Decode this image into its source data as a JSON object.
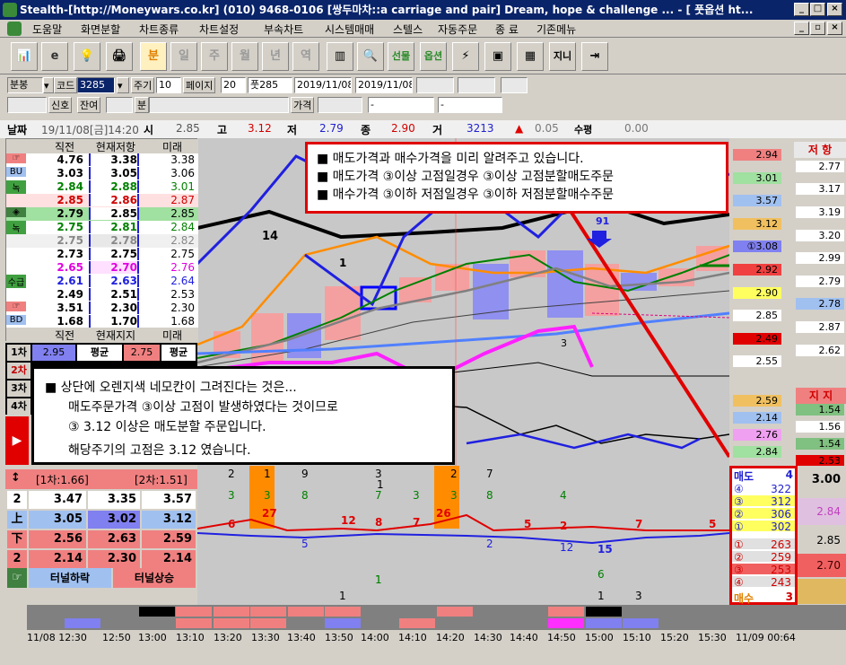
{
  "window": {
    "title": "Stealth-[http://Moneywars.co.kr] (010) 9468-0106 [쌍두마차::a carriage and pair] Dream, hope & challenge ... - [ 풋옵션 ht...",
    "controls": [
      "_",
      "□",
      "×"
    ],
    "mdi_controls": [
      "_",
      "▫",
      "×"
    ]
  },
  "menu": {
    "items": [
      "도움말",
      "화면분할",
      "차트종류",
      "차트설정",
      "부속차트",
      "시스템매매",
      "스텔스",
      "자동주문",
      "종 료",
      "기존메뉴"
    ]
  },
  "toolbar": {
    "buttons": [
      "📊",
      "e",
      "💡",
      "🖨",
      "분",
      "일",
      "주",
      "월",
      "년",
      "역",
      "▥",
      "🔍",
      "선물",
      "옵션",
      "⚡",
      "▣",
      "▦",
      "지니",
      "⇥"
    ]
  },
  "controls": {
    "period_select": "분봉",
    "code_label": "코드",
    "code_value": "3285",
    "cycle_label": "주기",
    "cycle_value": "10",
    "page_label": "페이지",
    "page_value": "20",
    "put_label": "풋285",
    "date_from": "2019/11/08",
    "date_to": "2019/11/08",
    "signal_label": "신호",
    "balance_label": "잔여",
    "min_label": "분",
    "price_label": "가격",
    "dash1": "-",
    "dash2": "-"
  },
  "price_bar": {
    "date_label": "날짜",
    "datetime": "19/11/08[금]14:20",
    "open_label": "시",
    "open": "2.85",
    "high_label": "고",
    "high": "3.12",
    "low_label": "저",
    "low": "2.79",
    "close_label": "종",
    "close": "2.90",
    "volume_label": "거",
    "volume": "3213",
    "change": "0.05",
    "amount_label": "수평",
    "amount": "0.00"
  },
  "left_table": {
    "headers": [
      "직전",
      "현재저항",
      "미래"
    ],
    "rows": [
      {
        "tag": "☞",
        "prev": "4.76",
        "cur": "3.38",
        "fut": "3.38"
      },
      {
        "tag": "BU",
        "prev": "3.03",
        "cur": "3.05",
        "fut": "3.06"
      },
      {
        "tag": "녹",
        "prev": "2.84",
        "cur": "2.88",
        "fut": "3.01"
      },
      {
        "tag": "",
        "prev": "2.85",
        "cur": "2.86",
        "fut": "2.87"
      },
      {
        "tag": "◈",
        "prev": "2.79",
        "cur": "2.85",
        "fut": "2.85"
      },
      {
        "tag": "녹",
        "prev": "2.75",
        "cur": "2.81",
        "fut": "2.84"
      },
      {
        "tag": "",
        "prev": "2.75",
        "cur": "2.78",
        "fut": "2.82"
      },
      {
        "tag": "",
        "prev": "2.73",
        "cur": "2.75",
        "fut": "2.75"
      },
      {
        "tag": "",
        "prev": "2.65",
        "cur": "2.70",
        "fut": "2.76"
      },
      {
        "tag": "수급",
        "prev": "2.61",
        "cur": "2.63",
        "fut": "2.64"
      },
      {
        "tag": "",
        "prev": "2.49",
        "cur": "2.51",
        "fut": "2.53"
      },
      {
        "tag": "☞",
        "prev": "3.51",
        "cur": "2.30",
        "fut": "2.30"
      },
      {
        "tag": "BD",
        "prev": "1.68",
        "cur": "1.70",
        "fut": "1.68"
      }
    ],
    "footer": [
      "직전",
      "현재지지",
      "미래"
    ]
  },
  "avg_rows": {
    "row1_label": "1차",
    "row1_val1": "2.95",
    "row1_avg": "평균",
    "row1_val2": "2.75",
    "row1_avg2": "평균",
    "rows": [
      "2차",
      "3차",
      "4차"
    ]
  },
  "info_box_top": {
    "lines": [
      "■ 매도가격과 매수가격을 미리 알려주고 있습니다.",
      "■ 매도가격 ③이상 고점일경우 ③이상 고점분할매도주문",
      "■ 매수가격 ③이하 저점일경우 ③이하 저점분할매수주문"
    ]
  },
  "info_box_bottom": {
    "lines": [
      "■ 상단에 오렌지색 네모칸이 그려진다는 것은...",
      "매도주문가격 ③이상 고점이 발생하였다는 것이므로",
      "③ 3.12 이상은 매도분할 주문입니다.",
      "해당주기의 고점은 3.12 였습니다."
    ]
  },
  "chart_labels": {
    "top_num1": "14",
    "num1": "1",
    "num91": "91",
    "num3": "3",
    "sub_numbers": [
      "2",
      "1",
      "9",
      "3",
      "1",
      "2",
      "7",
      "3",
      "3",
      "8",
      "7",
      "3",
      "3",
      "8",
      "4",
      "6",
      "27",
      "12",
      "8",
      "7",
      "26",
      "5",
      "2",
      "7",
      "5",
      "5",
      "2",
      "12",
      "15",
      "6",
      "1",
      "1",
      "3",
      "1",
      "1"
    ]
  },
  "right_panel": {
    "header1": "저 항",
    "values1": [
      "2.94",
      "2.77",
      "3.01",
      "3.17",
      "3.57",
      "3.19",
      "3.12",
      "3.20",
      "①3.08",
      "2.99",
      "2.92",
      "2.79",
      "2.90",
      "2.78",
      "2.85",
      "2.87",
      "2.49",
      "2.62",
      "2.55"
    ],
    "header2": "지 지",
    "values2": [
      "2.59",
      "1.54",
      "2.14",
      "1.56",
      "2.76",
      "1.54",
      "2.84",
      "2.53"
    ]
  },
  "bottom_left": {
    "row0_icon": "↕",
    "row0_a": "[1차:1.66]",
    "row0_b": "[2차:1.51]",
    "rows": [
      {
        "tag": "2",
        "a": "3.47",
        "b": "3.35",
        "c": "3.57"
      },
      {
        "tag": "上",
        "a": "3.05",
        "b": "3.02",
        "c": "3.12"
      },
      {
        "tag": "下",
        "a": "2.56",
        "b": "2.63",
        "c": "2.59"
      },
      {
        "tag": "2",
        "a": "2.14",
        "b": "2.30",
        "c": "2.14"
      }
    ],
    "btn_icon": "☞",
    "btn_down": "터널하락",
    "btn_up": "터널상승"
  },
  "order_book": {
    "sell_label": "매도",
    "sell_count": "4",
    "sells": [
      {
        "k": "④",
        "v": "322"
      },
      {
        "k": "③",
        "v": "312"
      },
      {
        "k": "②",
        "v": "306"
      },
      {
        "k": "①",
        "v": "302"
      }
    ],
    "buys": [
      {
        "k": "①",
        "v": "263"
      },
      {
        "k": "②",
        "v": "259"
      },
      {
        "k": "③",
        "v": "253"
      },
      {
        "k": "④",
        "v": "243"
      }
    ],
    "buy_label": "매수",
    "buy_count": "3"
  },
  "order_side": {
    "v1": "3.00",
    "v2": "2.84",
    "v3": "2.85",
    "v4": "2.70"
  },
  "time_axis": {
    "labels": [
      "11/08 12:30",
      "12:50",
      "13:00",
      "13:10",
      "13:20",
      "13:30",
      "13:40",
      "13:50",
      "14:00",
      "14:10",
      "14:20",
      "14:30",
      "14:40",
      "14:50",
      "15:00",
      "15:10",
      "15:20",
      "15:30",
      "11/09 00:64"
    ]
  },
  "colors": {
    "accent_red": "#e00000",
    "bull": "#f08080",
    "bear": "#8080f0",
    "orange": "#ff8c00"
  }
}
